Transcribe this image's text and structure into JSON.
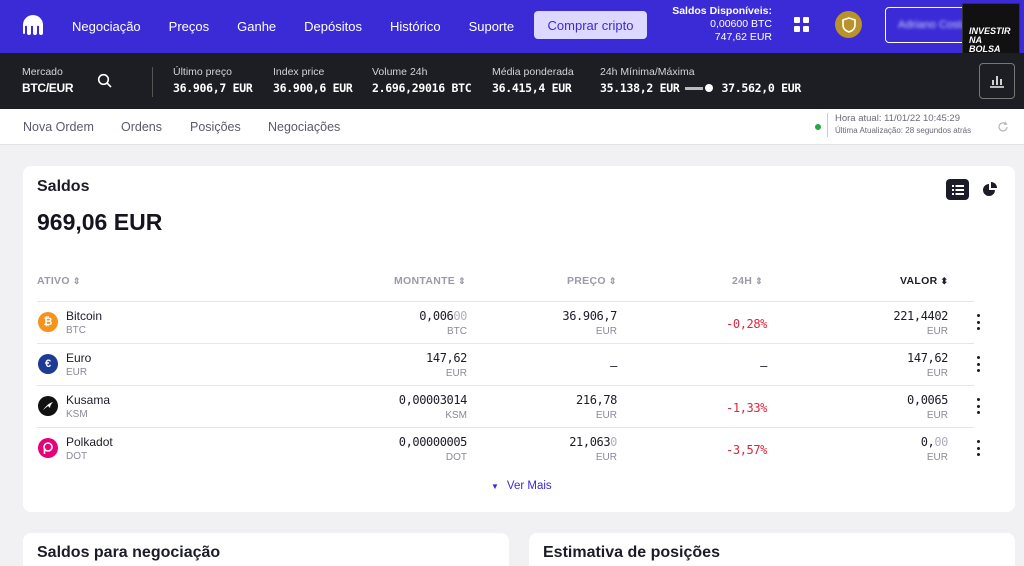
{
  "nav": {
    "links": [
      "Negociação",
      "Preços",
      "Ganhe",
      "Depósitos",
      "Histórico",
      "Suporte"
    ],
    "buy_label": "Comprar cripto",
    "balances_label": "Saldos Disponíveis:",
    "balance_btc": "0,00600 BTC",
    "balance_eur": "747,62 EUR",
    "user_name": "Adriano Costa",
    "promo_line1": "INVESTIR",
    "promo_line2": "NA BOLSA"
  },
  "ticker": {
    "market_label": "Mercado",
    "market_value": "BTC/EUR",
    "last_price_label": "Último preço",
    "last_price": "36.906,7 EUR",
    "index_label": "Index price",
    "index_price": "36.900,6 EUR",
    "volume_label": "Volume 24h",
    "volume": "2.696,29016 BTC",
    "vwap_label": "Média ponderada",
    "vwap": "36.415,4 EUR",
    "range_label": "24h Mínima/Máxima",
    "range_min": "35.138,2 EUR",
    "range_max": "37.562,0 EUR"
  },
  "subnav": {
    "tabs": [
      "Nova Ordem",
      "Ordens",
      "Posições",
      "Negociações"
    ],
    "time_label": "Hora atual: 11/01/22 10:45:29",
    "updated_label": "Última Atualização: 28 segundos atrás"
  },
  "balances": {
    "title": "Saldos",
    "total": "969,06 EUR",
    "headers": {
      "asset": "ATIVO",
      "amount": "MONTANTE",
      "price": "PREÇO",
      "change": "24H",
      "value": "VALOR"
    },
    "rows": [
      {
        "name": "Bitcoin",
        "symbol": "BTC",
        "amount": "0,006",
        "amount_fade": "00",
        "amount_unit": "BTC",
        "price": "36.906,7",
        "price_fade": "",
        "price_unit": "EUR",
        "change": "-0,28%",
        "value": "221,4402",
        "value_fade": "",
        "value_unit": "EUR",
        "icon": "bitcoin-icon",
        "color": "#f7931a"
      },
      {
        "name": "Euro",
        "symbol": "EUR",
        "amount": "147,62",
        "amount_fade": "",
        "amount_unit": "EUR",
        "price": "—",
        "price_fade": "",
        "price_unit": "",
        "change": "—",
        "value": "147,62",
        "value_fade": "",
        "value_unit": "EUR",
        "icon": "euro-icon",
        "color": "#1f3a93"
      },
      {
        "name": "Kusama",
        "symbol": "KSM",
        "amount": "0,00003014",
        "amount_fade": "",
        "amount_unit": "KSM",
        "price": "216,78",
        "price_fade": "",
        "price_unit": "EUR",
        "change": "-1,33%",
        "value": "0,0065",
        "value_fade": "",
        "value_unit": "EUR",
        "icon": "kusama-icon",
        "color": "#111111"
      },
      {
        "name": "Polkadot",
        "symbol": "DOT",
        "amount": "0,00000005",
        "amount_fade": "",
        "amount_unit": "DOT",
        "price": "21,063",
        "price_fade": "0",
        "price_unit": "EUR",
        "change": "-3,57%",
        "value": "0,",
        "value_fade": "00",
        "value_unit": "EUR",
        "icon": "polkadot-icon",
        "color": "#e6007a"
      }
    ],
    "more_label": "Ver Mais"
  },
  "bottom": {
    "trading_title": "Saldos para negociação",
    "positions_title": "Estimativa de posições"
  },
  "colors": {
    "brand": "#3b2bd6",
    "negative": "#e0243a"
  }
}
